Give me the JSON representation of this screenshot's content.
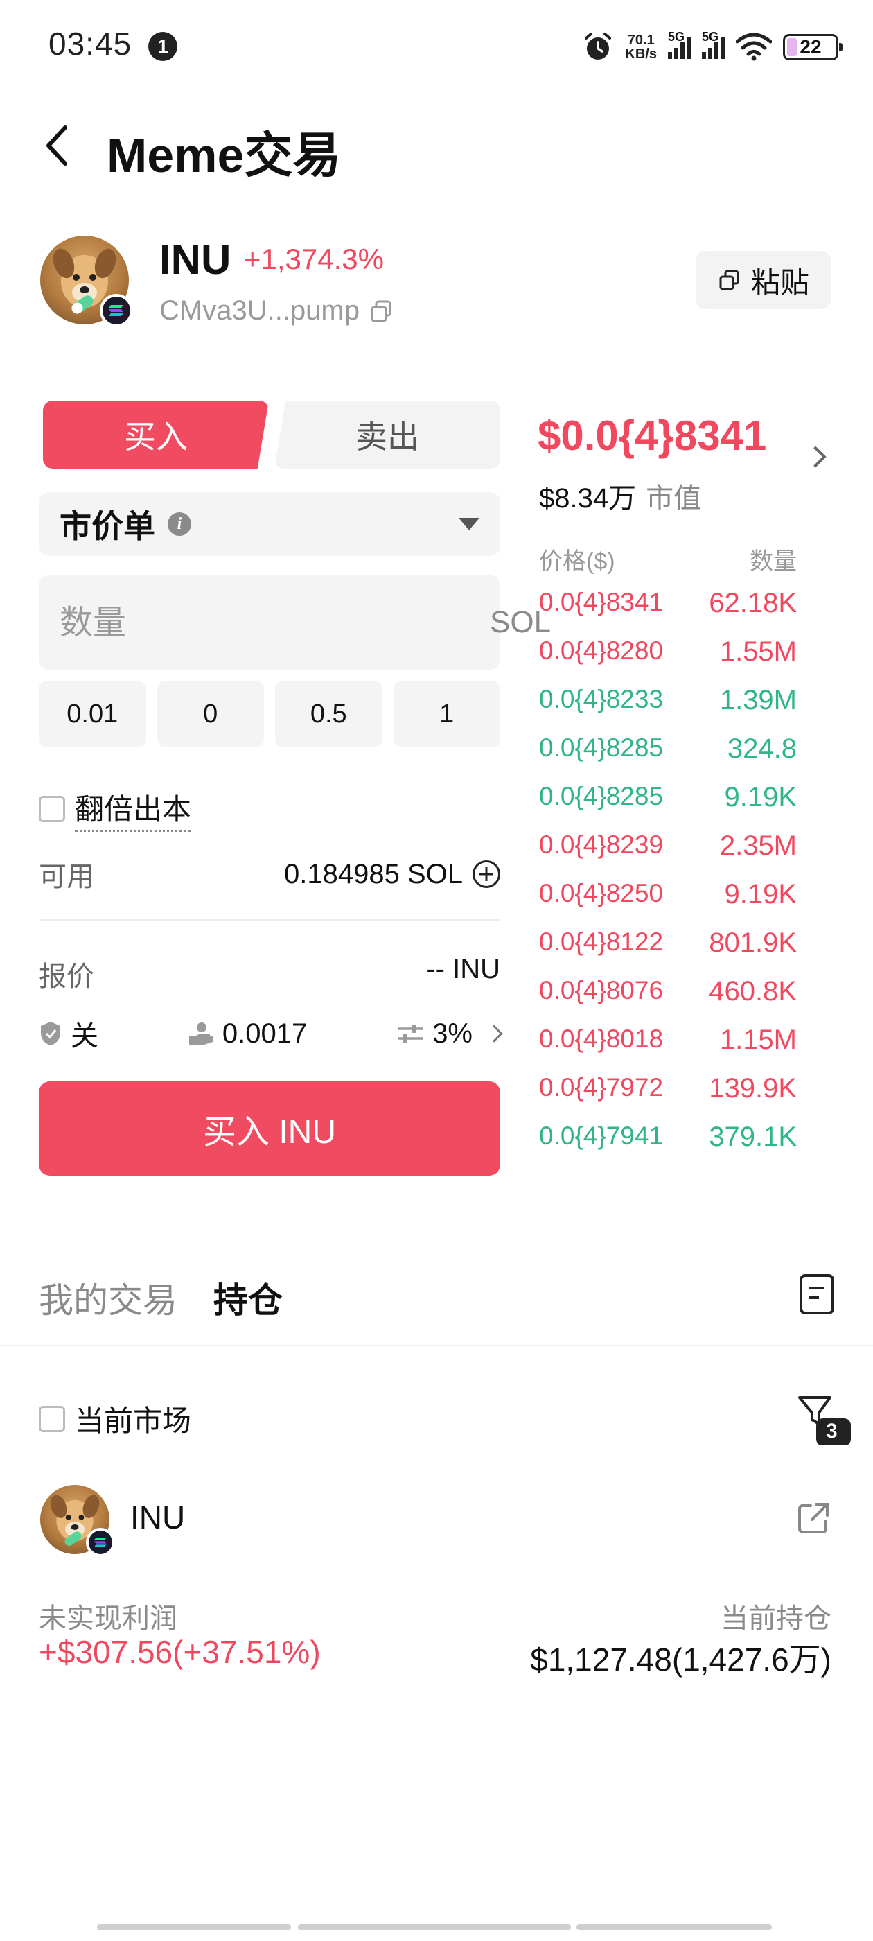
{
  "status_bar": {
    "time": "03:45",
    "notification_count": "1",
    "net_speed_value": "70.1",
    "net_speed_unit": "KB/s",
    "signal1_label": "5G",
    "signal2_label": "5G",
    "battery": "22"
  },
  "header": {
    "title": "Meme交易"
  },
  "token": {
    "symbol": "INU",
    "change": "+1,374.3%",
    "address": "CMva3U...pump",
    "paste_label": "粘贴"
  },
  "trade": {
    "buy_tab": "买入",
    "sell_tab": "卖出",
    "order_type": "市价单",
    "amount_placeholder": "数量",
    "amount_unit": "SOL",
    "presets": [
      "0.01",
      "0",
      "0.5",
      "1"
    ],
    "double_label": "翻倍出本",
    "available_label": "可用",
    "available_value": "0.184985 SOL",
    "quote_label": "报价",
    "quote_value": "-- INU",
    "mev_value": "关",
    "priority_fee": "0.0017",
    "slippage": "3%",
    "buy_button": "买入 INU"
  },
  "order_book": {
    "price": "$0.0{4}8341",
    "market_cap_value": "$8.34万",
    "market_cap_label": "市值",
    "header_price": "价格($)",
    "header_qty": "数量",
    "rows": [
      {
        "price": "0.0{4}8341",
        "qty": "62.18K",
        "side": "sell"
      },
      {
        "price": "0.0{4}8280",
        "qty": "1.55M",
        "side": "sell"
      },
      {
        "price": "0.0{4}8233",
        "qty": "1.39M",
        "side": "buy"
      },
      {
        "price": "0.0{4}8285",
        "qty": "324.8",
        "side": "buy"
      },
      {
        "price": "0.0{4}8285",
        "qty": "9.19K",
        "side": "buy"
      },
      {
        "price": "0.0{4}8239",
        "qty": "2.35M",
        "side": "sell"
      },
      {
        "price": "0.0{4}8250",
        "qty": "9.19K",
        "side": "sell"
      },
      {
        "price": "0.0{4}8122",
        "qty": "801.9K",
        "side": "sell"
      },
      {
        "price": "0.0{4}8076",
        "qty": "460.8K",
        "side": "sell"
      },
      {
        "price": "0.0{4}8018",
        "qty": "1.15M",
        "side": "sell"
      },
      {
        "price": "0.0{4}7972",
        "qty": "139.9K",
        "side": "sell"
      },
      {
        "price": "0.0{4}7941",
        "qty": "379.1K",
        "side": "buy"
      }
    ],
    "colors": {
      "sell": "#f0485f",
      "buy": "#2fb587"
    }
  },
  "bottom": {
    "tab_my_trades": "我的交易",
    "tab_positions": "持仓",
    "current_market_label": "当前市场",
    "filter_count": "3",
    "position": {
      "symbol": "INU",
      "pnl_label": "未实现利润",
      "pnl_value": "+$307.56(+37.51%)",
      "holding_label": "当前持仓",
      "holding_value": "$1,127.48(1,427.6万)"
    }
  }
}
